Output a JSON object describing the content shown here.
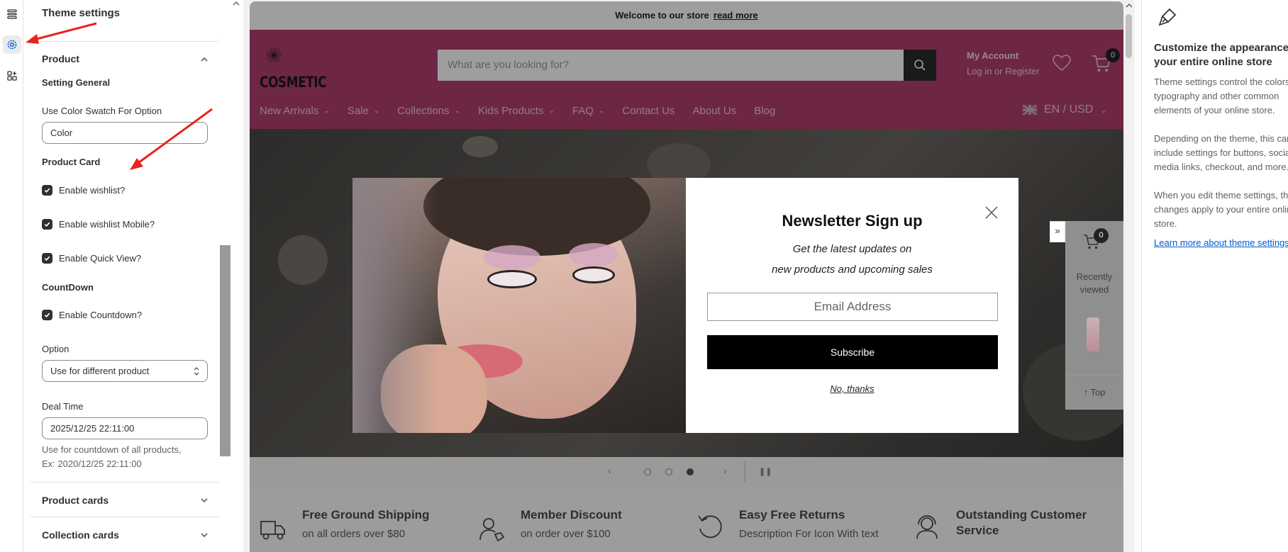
{
  "sidebar_rail": {
    "items": [
      {
        "name": "sections",
        "icon": "sections-icon"
      },
      {
        "name": "theme-settings",
        "icon": "gear-icon",
        "active": true
      },
      {
        "name": "apps",
        "icon": "apps-icon"
      }
    ]
  },
  "settings_panel": {
    "title": "Theme settings",
    "product_section": {
      "title": "Product",
      "setting_general": "Setting General",
      "color_swatch": {
        "label": "Use Color Swatch For Option",
        "value": "Color"
      },
      "product_card_heading": "Product Card",
      "checkboxes": [
        {
          "label": "Enable wishlist?",
          "checked": true
        },
        {
          "label": "Enable wishlist Mobile?",
          "checked": true
        },
        {
          "label": "Enable Quick View?",
          "checked": true
        }
      ],
      "countdown_heading": "CountDown",
      "countdown_checkbox": {
        "label": "Enable Countdown?",
        "checked": true
      },
      "option": {
        "label": "Option",
        "value": "Use for different product"
      },
      "deal_time": {
        "label": "Deal Time",
        "value": "2025/12/25 22:11:00",
        "help_line1": "Use for countdown of all products,",
        "help_line2": "Ex: 2020/12/25 22:11:00"
      }
    },
    "collapsed_sections": [
      "Product cards",
      "Collection cards"
    ]
  },
  "store_preview": {
    "announcement": {
      "text": "Welcome to our store",
      "link": "read more"
    },
    "logo_text": "COSMETIC",
    "search_placeholder": "What are you looking for?",
    "account": {
      "title": "My Account",
      "sub": "Log in or Register"
    },
    "cart_count": "0",
    "nav": [
      "New Arrivals",
      "Sale",
      "Collections",
      "Kids Products",
      "FAQ",
      "Contact Us",
      "About Us",
      "Blog"
    ],
    "nav_has_dropdown": [
      true,
      true,
      true,
      true,
      true,
      false,
      false,
      false
    ],
    "language_currency": "EN / USD",
    "colors": {
      "header": "#b23e70",
      "modal_button": "#000000"
    },
    "newsletter": {
      "title": "Newsletter Sign up",
      "subtitle_line1": "Get the latest updates on",
      "subtitle_line2": "new products and upcoming sales",
      "email_placeholder": "Email Address",
      "subscribe": "Subscribe",
      "dismiss": "No, thanks"
    },
    "recently_viewed": {
      "count": "0",
      "label": "Recently viewed",
      "top": "Top"
    },
    "slider": {
      "dots": 3,
      "active_dot": 3
    },
    "features": [
      {
        "title": "Free Ground Shipping",
        "sub": "on all orders over $80",
        "icon": "truck-icon"
      },
      {
        "title": "Member Discount",
        "sub": "on order over $100",
        "icon": "member-tag-icon"
      },
      {
        "title": "Easy Free Returns",
        "sub": "Description For Icon With text",
        "icon": "return-arrow-icon"
      },
      {
        "title": "Outstanding Customer",
        "sub": "Service",
        "icon": "support-headset-icon"
      }
    ]
  },
  "info_panel": {
    "icon": "paintbrush-icon",
    "heading_line1": "Customize the appearance of",
    "heading_line2": "your entire online store",
    "p1": [
      "Theme settings control the colors,",
      "typography and other common",
      "elements of your online store."
    ],
    "p2": [
      "Depending on the theme, this can",
      "include settings for buttons, social",
      "media links, checkout, and more."
    ],
    "p3": [
      "When you edit theme settings, the",
      "changes apply to your entire online",
      "store."
    ],
    "link": "Learn more about theme settings"
  }
}
